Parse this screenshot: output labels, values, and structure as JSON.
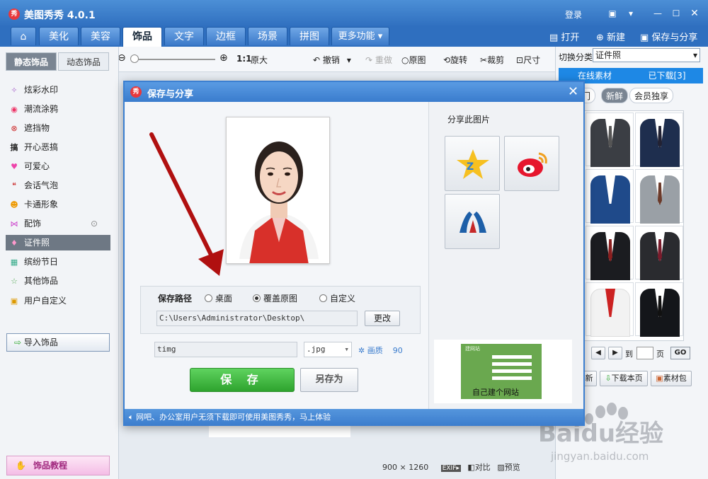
{
  "app": {
    "title": "美图秀秀 4.0.1",
    "login": "登录",
    "logo_text": "秀"
  },
  "tabs": [
    {
      "label": "美化"
    },
    {
      "label": "美容"
    },
    {
      "label": "饰品"
    },
    {
      "label": "文字"
    },
    {
      "label": "边框"
    },
    {
      "label": "场景"
    },
    {
      "label": "拼图"
    },
    {
      "label": "更多功能 ▾"
    }
  ],
  "top_actions": {
    "open": "打开",
    "new": "新建",
    "save_share": "保存与分享"
  },
  "toolbar": {
    "ratio": "1:1",
    "original_size": "原大",
    "undo": "撤销",
    "redo": "重做",
    "original": "原图",
    "rotate": "旋转",
    "crop": "裁剪",
    "size": "尺寸"
  },
  "left": {
    "tabs": [
      {
        "label": "静态饰品"
      },
      {
        "label": "动态饰品"
      }
    ],
    "items": [
      {
        "label": "炫彩水印"
      },
      {
        "label": "潮流涂鸦"
      },
      {
        "label": "遮挡物"
      },
      {
        "label": "开心恶搞"
      },
      {
        "label": "可爱心"
      },
      {
        "label": "会话气泡"
      },
      {
        "label": "卡通形象"
      },
      {
        "label": "配饰"
      },
      {
        "label": "证件照"
      },
      {
        "label": "缤纷节日"
      },
      {
        "label": "其他饰品"
      },
      {
        "label": "用户自定义"
      }
    ],
    "import_label": "导入饰品",
    "tutorial_label": "饰品教程"
  },
  "right": {
    "category_label": "切换分类",
    "category_value": "证件照",
    "tabs": [
      {
        "label": "在线素材"
      },
      {
        "label": "已下载[3]"
      }
    ],
    "subtabs": [
      {
        "label": "门"
      },
      {
        "label": "新鲜"
      },
      {
        "label": "会员独享"
      }
    ],
    "page_suffix": "页",
    "go_label": "GO",
    "refresh_label": "新",
    "download_page": "下载本页",
    "material_bag": "素材包"
  },
  "status": {
    "dimensions": "900 × 1260",
    "exif": "EXIF▸",
    "compare": "对比",
    "preview": "预览"
  },
  "dialog": {
    "title": "保存与分享",
    "save_path_label": "保存路径",
    "options": [
      {
        "label": "桌面"
      },
      {
        "label": "覆盖原图"
      },
      {
        "label": "自定义"
      }
    ],
    "selected_option": "覆盖原图",
    "path_value": "C:\\Users\\Administrator\\Desktop\\",
    "change_button": "更改",
    "filename": "timg",
    "format": ".jpg",
    "quality_label": "画质",
    "quality_value": "90",
    "save_button": "保 存",
    "save_as_button": "另存为",
    "share_title": "分享此图片",
    "ad_caption": "自己建个网站",
    "ad_top": "建网站",
    "footer": "网吧、办公室用户无须下载即可使用美图秀秀，马上体验"
  },
  "watermark": {
    "brand": "Baidu经验",
    "url": "jingyan.baidu.com"
  },
  "colors": {
    "accent": "#3b7fd0",
    "save_green": "#2ea32e",
    "active_tab": "#1e88e5",
    "highlight": "#6e7884"
  }
}
